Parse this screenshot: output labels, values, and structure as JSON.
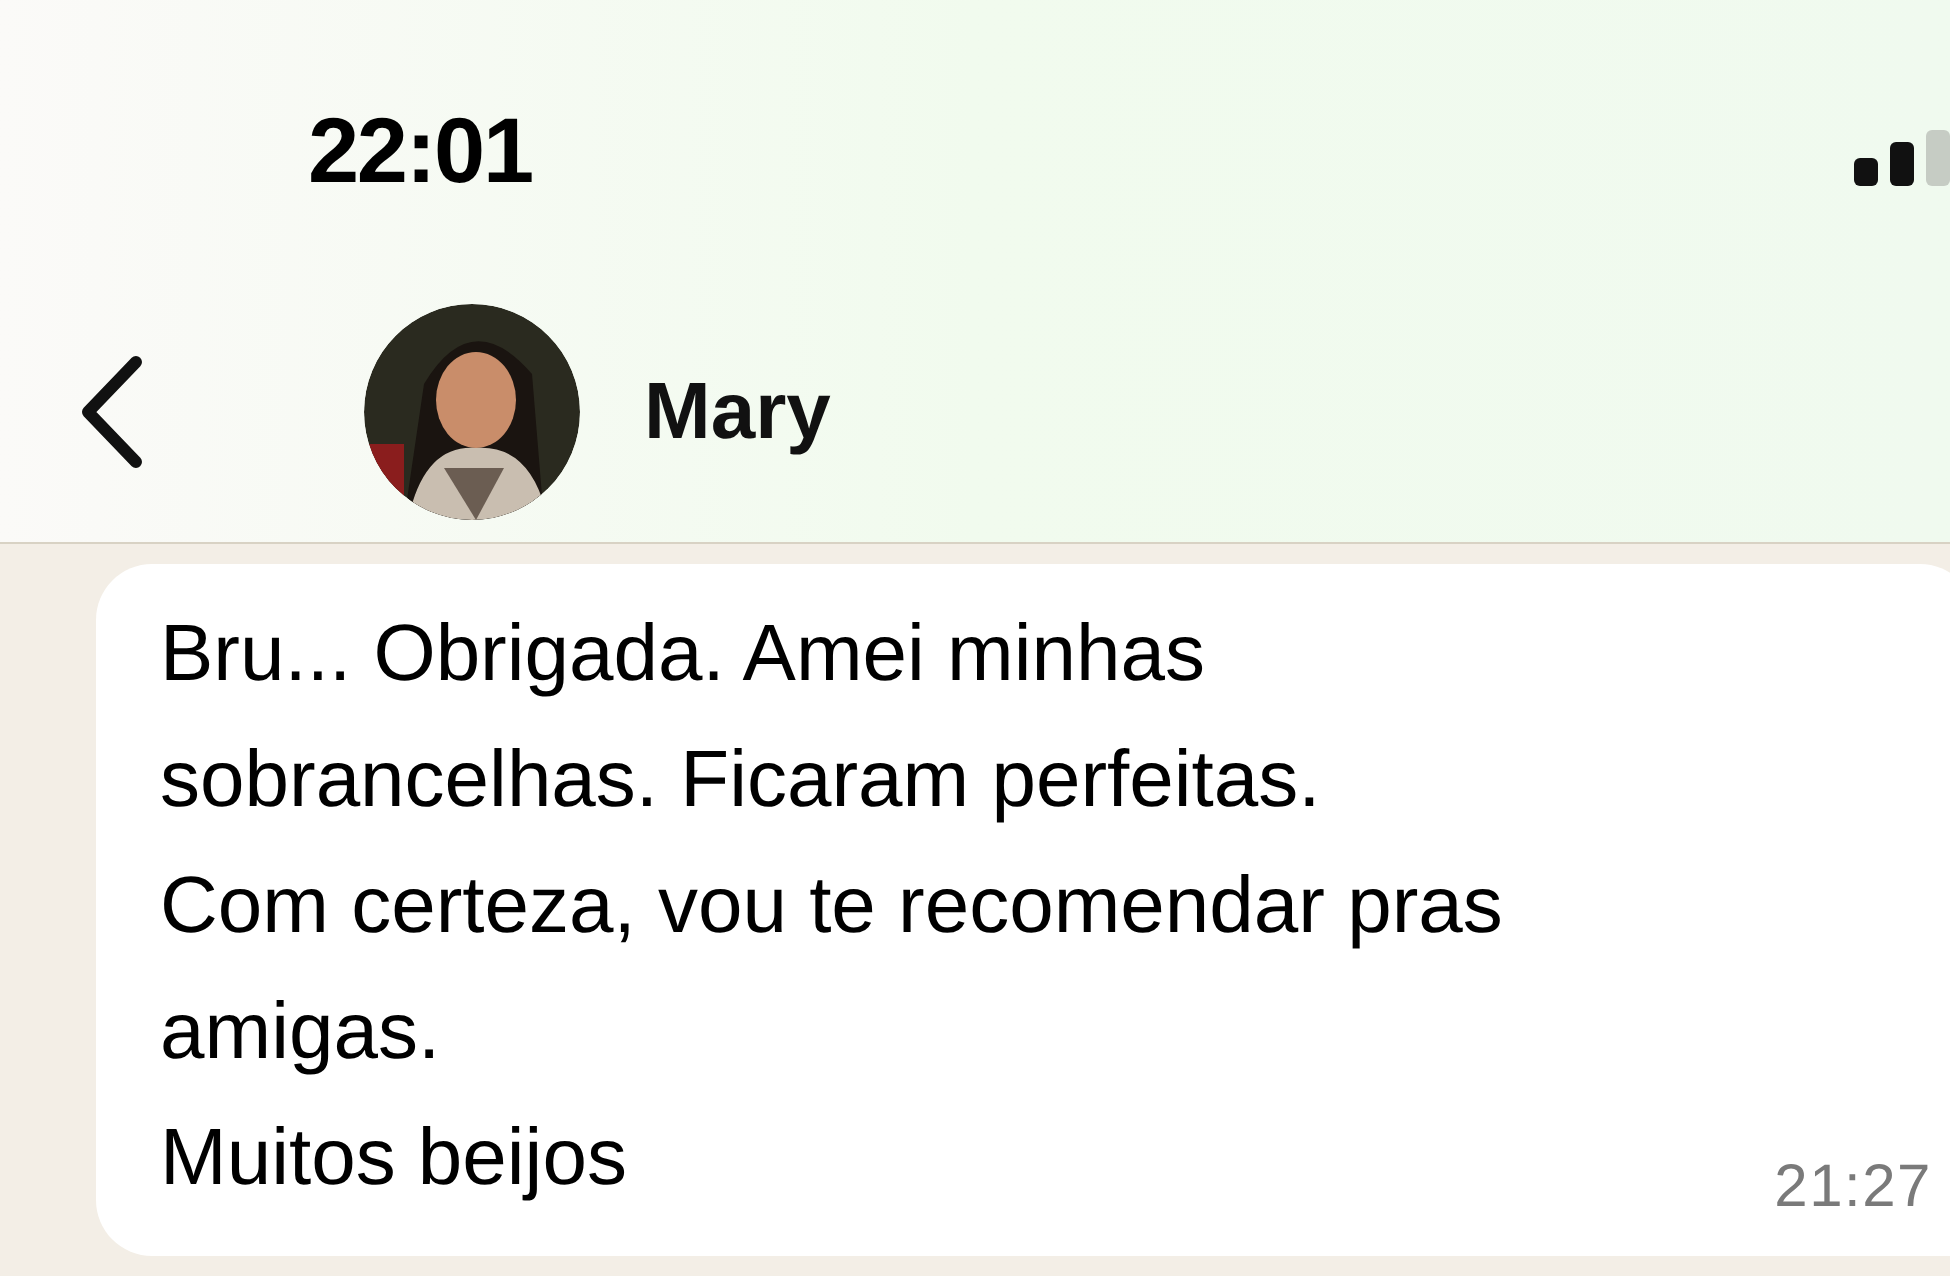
{
  "status_bar": {
    "time": "22:01"
  },
  "header": {
    "contact_name": "Mary"
  },
  "messages": [
    {
      "lines": [
        "Bru... Obrigada. Amei minhas",
        "sobrancelhas. Ficaram perfeitas.",
        "Com certeza, vou te recomendar pras",
        "amigas.",
        "Muitos beijos"
      ],
      "time": "21:27"
    }
  ]
}
